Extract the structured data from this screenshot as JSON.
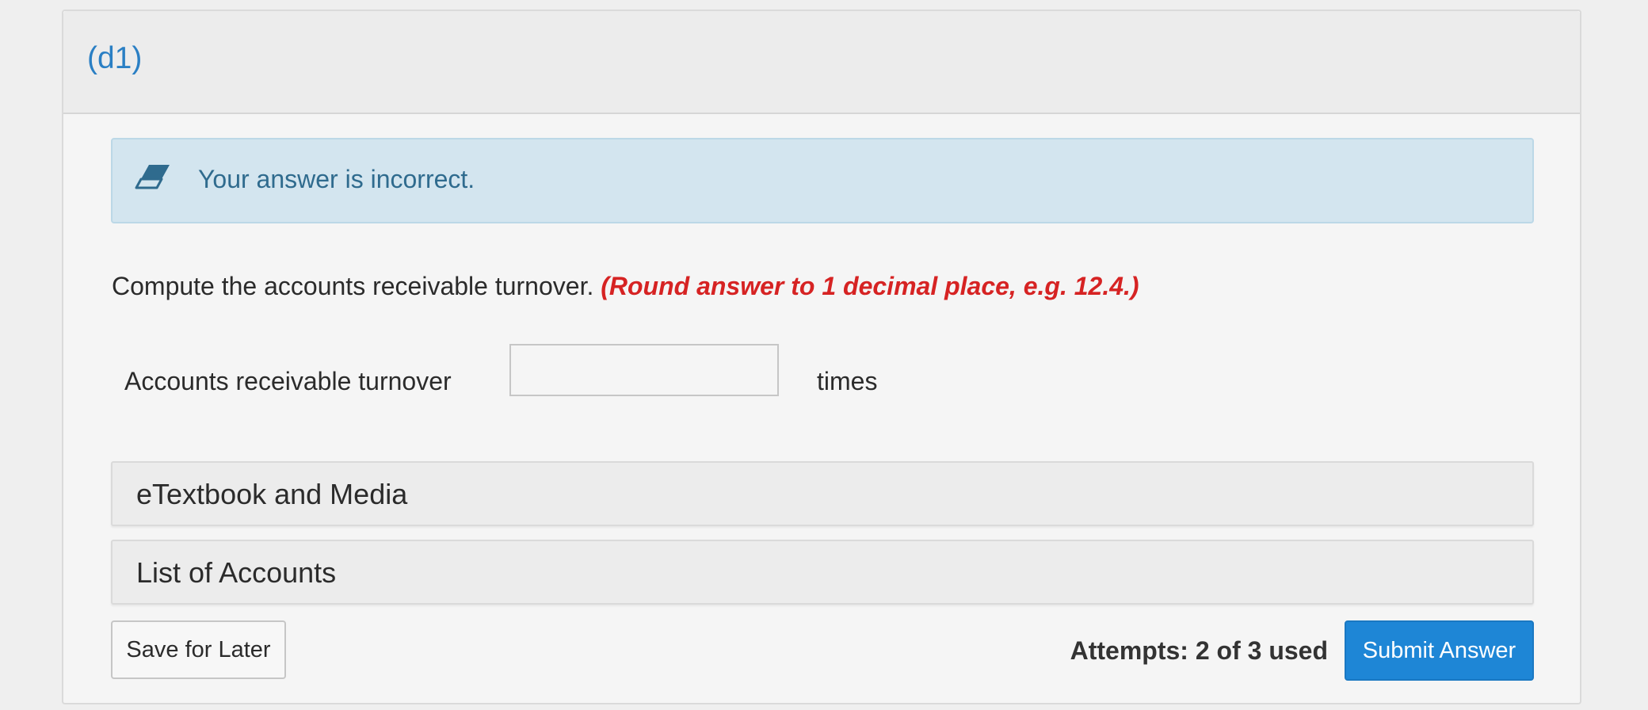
{
  "part": {
    "title": "(d1)"
  },
  "feedback": {
    "icon": "eraser-icon",
    "message": "Your answer is incorrect."
  },
  "question": {
    "text": "Compute the accounts receivable turnover.",
    "hint": "(Round answer to 1 decimal place, e.g. 12.4.)"
  },
  "answer": {
    "label": "Accounts receivable turnover",
    "value": "",
    "unit": "times"
  },
  "resources": {
    "items": [
      {
        "label": "eTextbook and Media"
      },
      {
        "label": "List of Accounts"
      }
    ]
  },
  "footer": {
    "save_label": "Save for Later",
    "attempts_text": "Attempts: 2 of 3 used",
    "submit_label": "Submit Answer"
  },
  "colors": {
    "accent": "#1e86d6",
    "title": "#2a7fc4",
    "alert_bg": "#d3e5ef",
    "alert_text": "#2f6b8e",
    "hint": "#d62323"
  }
}
